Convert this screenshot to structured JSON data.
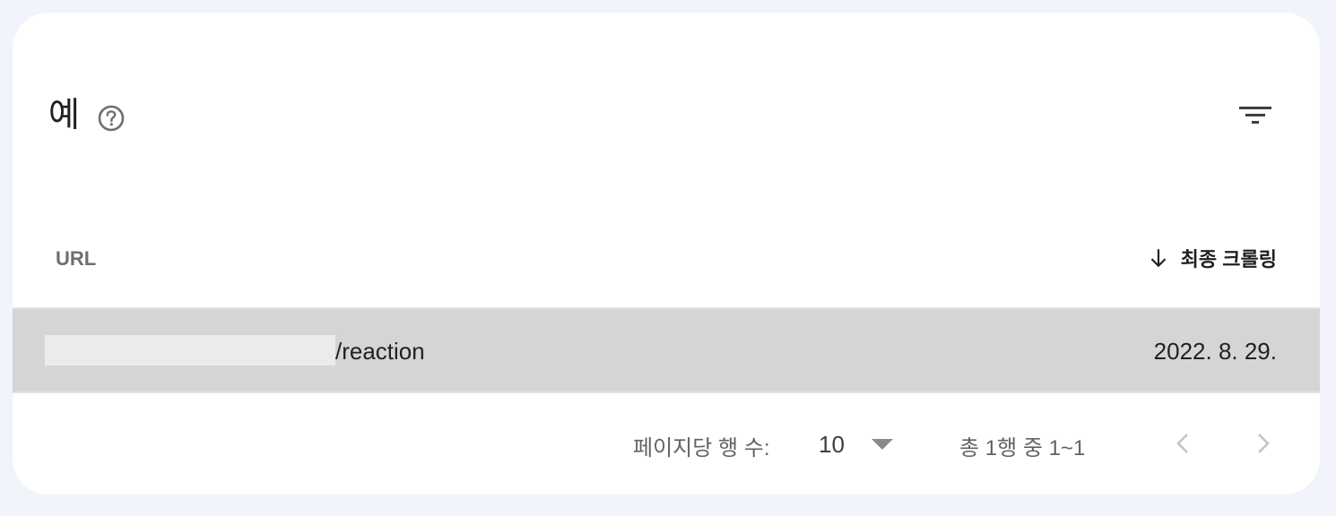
{
  "card": {
    "title": "예",
    "help_icon": "help-circle-icon",
    "filter_icon": "filter-icon"
  },
  "table": {
    "columns": [
      {
        "label": "URL"
      },
      {
        "label": "최종 크롤링",
        "sort": "descending",
        "sort_icon": "arrow-down-icon"
      }
    ],
    "rows": [
      {
        "url_suffix": "/reaction",
        "last_crawled": "2022. 8. 29."
      }
    ]
  },
  "pagination": {
    "rows_per_page_label": "페이지당 행 수:",
    "rows_per_page_value": "10",
    "range_text": "총 1행 중 1~1",
    "prev_icon": "chevron-left-icon",
    "next_icon": "chevron-right-icon"
  },
  "colors": {
    "background": "#f1f4fb",
    "card": "#ffffff",
    "selected_row": "#d5d5d5",
    "redaction": "#ebebeb"
  }
}
